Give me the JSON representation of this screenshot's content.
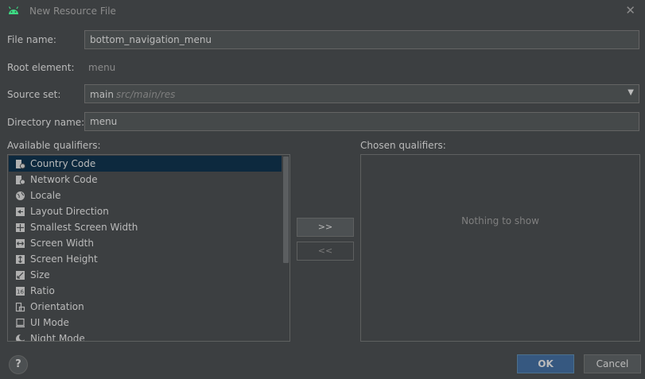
{
  "window": {
    "title": "New Resource File"
  },
  "form": {
    "file_name_label": "File name:",
    "file_name_value": "bottom_navigation_menu",
    "root_element_label": "Root element:",
    "root_element_value": "menu",
    "source_set_label": "Source set:",
    "source_set_value": "main",
    "source_set_hint": "src/main/res",
    "directory_name_label": "Directory name:",
    "directory_name_value": "menu"
  },
  "qualifiers": {
    "available_label": "Available qualifiers:",
    "chosen_label": "Chosen qualifiers:",
    "empty_text": "Nothing to show",
    "items": [
      {
        "label": "Country Code",
        "icon": "country-code-icon",
        "selected": true
      },
      {
        "label": "Network Code",
        "icon": "network-code-icon",
        "selected": false
      },
      {
        "label": "Locale",
        "icon": "globe-icon",
        "selected": false
      },
      {
        "label": "Layout Direction",
        "icon": "layout-direction-icon",
        "selected": false
      },
      {
        "label": "Smallest Screen Width",
        "icon": "smallest-screen-width-icon",
        "selected": false
      },
      {
        "label": "Screen Width",
        "icon": "screen-width-icon",
        "selected": false
      },
      {
        "label": "Screen Height",
        "icon": "screen-height-icon",
        "selected": false
      },
      {
        "label": "Size",
        "icon": "size-icon",
        "selected": false
      },
      {
        "label": "Ratio",
        "icon": "ratio-icon",
        "selected": false
      },
      {
        "label": "Orientation",
        "icon": "orientation-icon",
        "selected": false
      },
      {
        "label": "UI Mode",
        "icon": "ui-mode-icon",
        "selected": false
      },
      {
        "label": "Night Mode",
        "icon": "night-mode-icon",
        "selected": false
      }
    ],
    "add_button": ">>",
    "remove_button": "<<"
  },
  "buttons": {
    "help": "?",
    "ok": "OK",
    "cancel": "Cancel"
  },
  "colors": {
    "background": "#3c3f41",
    "selection": "#0d293e",
    "primary_button": "#365880",
    "android_green": "#3ddc84"
  }
}
